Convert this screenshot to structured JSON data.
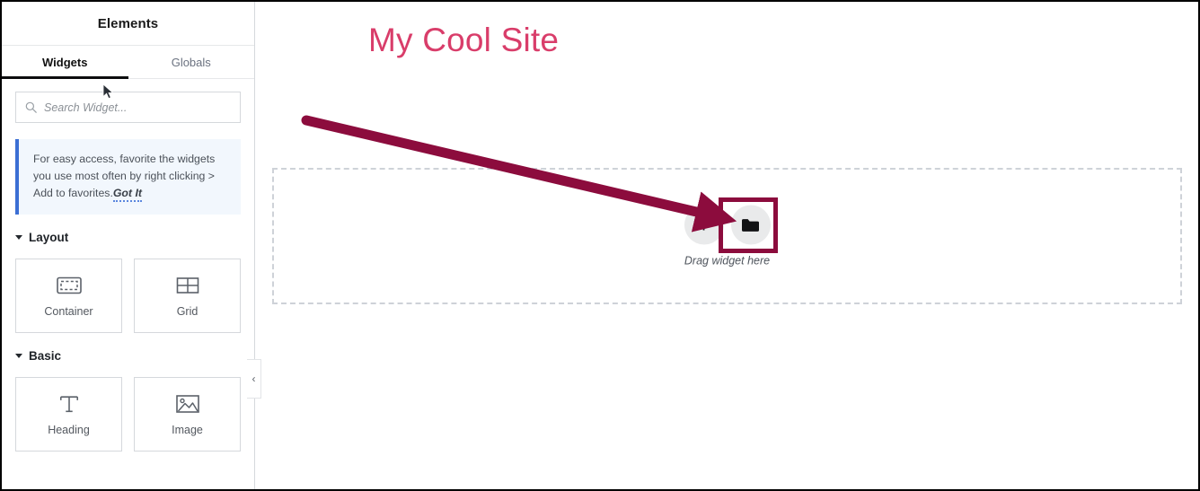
{
  "sidebar": {
    "panel_title": "Elements",
    "collapse_icon": "chevron-left-icon",
    "tabs": [
      {
        "label": "Widgets",
        "active": true
      },
      {
        "label": "Globals",
        "active": false
      }
    ],
    "search": {
      "icon": "search-icon",
      "placeholder": "Search Widget...",
      "value": ""
    },
    "notice": {
      "text": "For easy access, favorite the widgets you use most often by right clicking > Add to favorites.",
      "link_label": "Got It",
      "accent_color": "#3b6fd4",
      "background_color": "#f2f7fd"
    },
    "sections": [
      {
        "title": "Layout",
        "caret_icon": "caret-down-icon",
        "widgets": [
          {
            "label": "Container",
            "icon": "container-icon"
          },
          {
            "label": "Grid",
            "icon": "grid-icon"
          }
        ]
      },
      {
        "title": "Basic",
        "caret_icon": "caret-down-icon",
        "widgets": [
          {
            "label": "Heading",
            "icon": "heading-icon"
          },
          {
            "label": "Image",
            "icon": "image-icon"
          }
        ]
      }
    ]
  },
  "canvas": {
    "site_title": "My Cool Site",
    "site_title_color": "#d93d6a",
    "dropzone": {
      "add_button_icon": "plus-icon",
      "folder_button_icon": "folder-icon",
      "caption": "Drag widget here"
    }
  },
  "annotations": {
    "arrow_color": "#8c0c3d",
    "highlight_color": "#8c0c3d",
    "highlight_target": "folder-button"
  }
}
